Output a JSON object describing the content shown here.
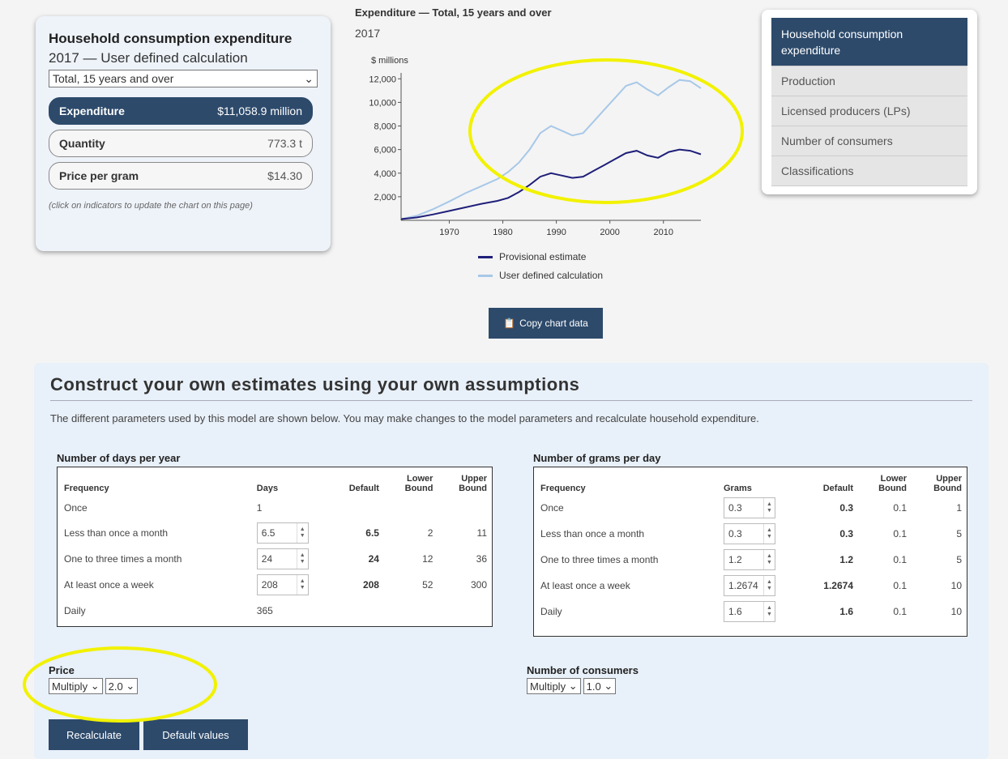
{
  "left_card": {
    "title": "Household consumption expenditure",
    "subtitle": "2017 — User defined calculation",
    "population_select": "Total, 15 years and over",
    "indicators": [
      {
        "label": "Expenditure",
        "value": "$11,058.9 million",
        "active": true
      },
      {
        "label": "Quantity",
        "value": "773.3 t",
        "active": false
      },
      {
        "label": "Price per gram",
        "value": "$14.30",
        "active": false
      }
    ],
    "hint": "(click on indicators to update the chart on this page)"
  },
  "chart": {
    "title": "Expenditure — Total, 15 years and over",
    "year": "2017",
    "unit_label": "$ millions",
    "legend": [
      "Provisional estimate",
      "User defined calculation"
    ],
    "copy_button": "Copy chart data"
  },
  "chart_data": {
    "type": "line",
    "title": "Expenditure — Total, 15 years and over",
    "ylabel": "$ millions",
    "ylim": [
      0,
      12500
    ],
    "xlim": [
      1961,
      2017
    ],
    "x_ticks": [
      1970,
      1980,
      1990,
      2000,
      2010
    ],
    "y_ticks": [
      2000,
      4000,
      6000,
      8000,
      10000,
      12000
    ],
    "x": [
      1961,
      1964,
      1967,
      1970,
      1973,
      1976,
      1979,
      1981,
      1983,
      1985,
      1987,
      1989,
      1991,
      1993,
      1995,
      1997,
      1999,
      2001,
      2003,
      2005,
      2007,
      2009,
      2011,
      2013,
      2015,
      2017
    ],
    "series": [
      {
        "name": "Provisional estimate",
        "color": "#1f1f7a",
        "values": [
          100,
          250,
          500,
          800,
          1100,
          1400,
          1650,
          1900,
          2400,
          3000,
          3700,
          4000,
          3800,
          3600,
          3700,
          4200,
          4700,
          5200,
          5700,
          5900,
          5500,
          5300,
          5800,
          6000,
          5900,
          5600
        ]
      },
      {
        "name": "User defined calculation",
        "color": "#a7c8e8",
        "values": [
          100,
          400,
          950,
          1600,
          2300,
          2900,
          3500,
          4100,
          4900,
          6000,
          7400,
          8000,
          7600,
          7200,
          7400,
          8400,
          9400,
          10400,
          11400,
          11700,
          11100,
          10600,
          11300,
          11900,
          11800,
          11200
        ]
      }
    ]
  },
  "right_nav": {
    "items": [
      {
        "label": "Household consumption expenditure",
        "active": true
      },
      {
        "label": "Production",
        "active": false
      },
      {
        "label": "Licensed producers (LPs)",
        "active": false
      },
      {
        "label": "Number of consumers",
        "active": false
      },
      {
        "label": "Classifications",
        "active": false
      }
    ]
  },
  "panel": {
    "heading": "Construct your own estimates using your own assumptions",
    "description": "The different parameters used by this model are shown below. You may make changes to the model parameters and recalculate household expenditure.",
    "days_table": {
      "title": "Number of days per year",
      "headers": [
        "Frequency",
        "Days",
        "Default",
        "Lower Bound",
        "Upper Bound"
      ],
      "rows": [
        {
          "freq": "Once",
          "value": "1",
          "editable": false,
          "default": "",
          "lower": "",
          "upper": ""
        },
        {
          "freq": "Less than once a month",
          "value": "6.5",
          "editable": true,
          "default": "6.5",
          "lower": "2",
          "upper": "11"
        },
        {
          "freq": "One to three times a month",
          "value": "24",
          "editable": true,
          "default": "24",
          "lower": "12",
          "upper": "36"
        },
        {
          "freq": "At least once a week",
          "value": "208",
          "editable": true,
          "default": "208",
          "lower": "52",
          "upper": "300"
        },
        {
          "freq": "Daily",
          "value": "365",
          "editable": false,
          "default": "",
          "lower": "",
          "upper": ""
        }
      ]
    },
    "grams_table": {
      "title": "Number of grams per day",
      "headers": [
        "Frequency",
        "Grams",
        "Default",
        "Lower Bound",
        "Upper Bound"
      ],
      "rows": [
        {
          "freq": "Once",
          "value": "0.3",
          "editable": true,
          "default": "0.3",
          "lower": "0.1",
          "upper": "1"
        },
        {
          "freq": "Less than once a month",
          "value": "0.3",
          "editable": true,
          "default": "0.3",
          "lower": "0.1",
          "upper": "5"
        },
        {
          "freq": "One to three times a month",
          "value": "1.2",
          "editable": true,
          "default": "1.2",
          "lower": "0.1",
          "upper": "5"
        },
        {
          "freq": "At least once a week",
          "value": "1.2674",
          "editable": true,
          "default": "1.2674",
          "lower": "0.1",
          "upper": "10"
        },
        {
          "freq": "Daily",
          "value": "1.6",
          "editable": true,
          "default": "1.6",
          "lower": "0.1",
          "upper": "10"
        }
      ]
    },
    "price": {
      "label": "Price",
      "op": "Multiply",
      "factor": "2.0"
    },
    "consumers": {
      "label": "Number of consumers",
      "op": "Multiply",
      "factor": "1.0"
    },
    "buttons": {
      "recalculate": "Recalculate",
      "defaults": "Default values"
    }
  },
  "annotation_color": "#f2f200"
}
